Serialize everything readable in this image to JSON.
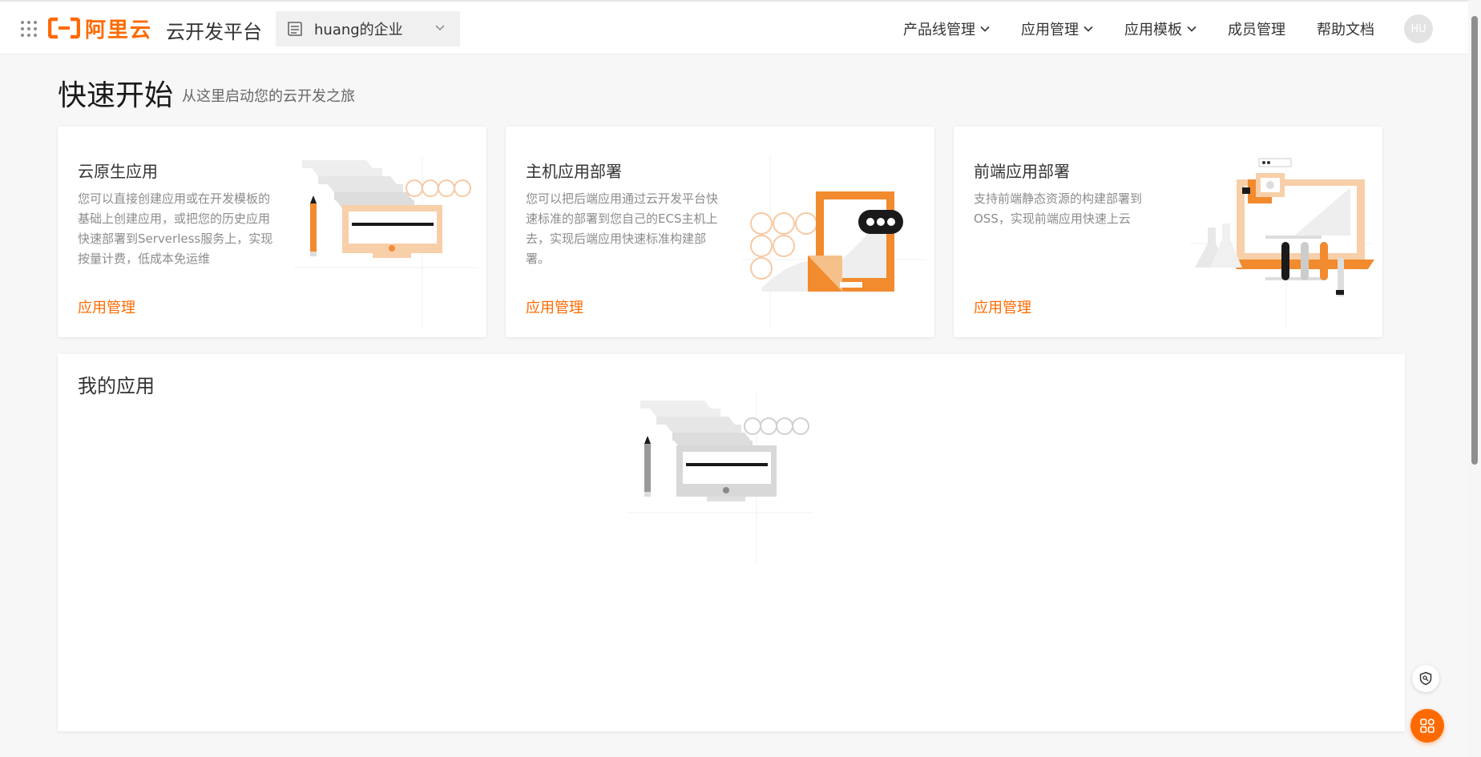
{
  "brand": {
    "logo_text": "阿里云",
    "app_title": "云开发平台",
    "accent_color": "#ff6a00"
  },
  "tenant": {
    "label": "huang的企业"
  },
  "nav": {
    "items": [
      {
        "label": "产品线管理",
        "has_dropdown": true
      },
      {
        "label": "应用管理",
        "has_dropdown": true
      },
      {
        "label": "应用模板",
        "has_dropdown": true
      },
      {
        "label": "成员管理",
        "has_dropdown": false
      },
      {
        "label": "帮助文档",
        "has_dropdown": false
      }
    ],
    "avatar_text": "HU"
  },
  "quick_start": {
    "title": "快速开始",
    "subtitle": "从这里启动您的云开发之旅",
    "cards": [
      {
        "title": "云原生应用",
        "description": "您可以直接创建应用或在开发模板的基础上创建应用，或把您的历史应用快速部署到Serverless服务上，实现按量计费，低成本免运维",
        "link": "应用管理"
      },
      {
        "title": "主机应用部署",
        "description": "您可以把后端应用通过云开发平台快速标准的部署到您自己的ECS主机上去，实现后端应用快速标准构建部署。",
        "link": "应用管理"
      },
      {
        "title": "前端应用部署",
        "description": "支持前端静态资源的构建部署到OSS，实现前端应用快速上云",
        "link": "应用管理"
      }
    ]
  },
  "my_apps": {
    "title": "我的应用"
  },
  "icons": {
    "apps_grid": "apps-grid-icon",
    "tenant": "enterprise-icon",
    "chevron": "chevron-down-icon",
    "shield": "shield-icon",
    "floating_apps": "apps-icon"
  }
}
